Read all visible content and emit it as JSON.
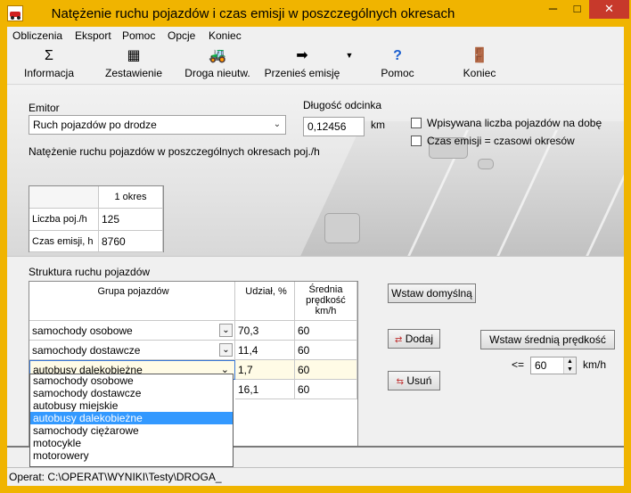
{
  "window": {
    "title": "Natężenie ruchu pojazdów i czas emisji w poszczególnych okresach",
    "min_glyph": "─",
    "max_glyph": "□",
    "close_glyph": "✕"
  },
  "menu": [
    "Obliczenia",
    "Eksport",
    "Pomoc",
    "Opcje",
    "Koniec"
  ],
  "toolbar": {
    "items": [
      {
        "label": "Informacja",
        "icon": "sigma-icon",
        "glyph": "Σ"
      },
      {
        "label": "Zestawienie",
        "icon": "table-icon",
        "glyph": "▦"
      },
      {
        "label": "Droga nieutw.",
        "icon": "road-vehicle-icon",
        "glyph": "🚜"
      },
      {
        "label": "Przenieś emisję",
        "icon": "transfer-icon",
        "glyph": "➡"
      },
      {
        "label": "Pomoc",
        "icon": "question-icon",
        "glyph": "?"
      },
      {
        "label": "Koniec",
        "icon": "exit-door-icon",
        "glyph": "🚪"
      }
    ],
    "dropdown_glyph": "▼"
  },
  "emitor": {
    "label": "Emitor",
    "value": "Ruch pojazdów po drodze",
    "arrow": "⌄"
  },
  "length": {
    "label": "Długość odcinka",
    "value": "0,12456",
    "unit": "km"
  },
  "checkboxes": [
    {
      "label": "Wpisywana liczba pojazdów na dobę",
      "checked": false
    },
    {
      "label": "Czas emisji = czasowi okresów",
      "checked": false
    }
  ],
  "intensity": {
    "heading": "Natężenie ruchu pojazdów w poszczególnych okresach poj./h",
    "column": "1 okres",
    "rows": [
      {
        "label": "Liczba poj./h",
        "value": "125"
      },
      {
        "label": "Czas emisji, h",
        "value": "8760"
      }
    ]
  },
  "structure": {
    "heading": "Struktura ruchu pojazdów",
    "headers": [
      "Grupa pojazdów",
      "Udział, %",
      "Średnia prędkość km/h"
    ],
    "rows": [
      {
        "group": "samochody osobowe",
        "share": "70,3",
        "speed": "60"
      },
      {
        "group": "samochody dostawcze",
        "share": "11,4",
        "speed": "60"
      },
      {
        "group": "autobusy dalekobieżne",
        "share": "1,7",
        "speed": "60"
      },
      {
        "group": "",
        "share": "16,1",
        "speed": "60"
      }
    ],
    "dropdown": [
      "samochody osobowe",
      "samochody dostawcze",
      "autobusy miejskie",
      "autobusy dalekobieżne",
      "samochody ciężarowe",
      "motocykle",
      "motorowery"
    ],
    "selected": "autobusy dalekobieżne"
  },
  "buttons": {
    "defaults": "Wstaw domyślną",
    "add": "Dodaj",
    "remove": "Usuń",
    "avg_speed": "Wstaw średnią prędkość"
  },
  "speed_limit": {
    "prefix": "<=",
    "value": "60",
    "unit": "km/h"
  },
  "status": "Operat: C:\\OPERAT\\WYNIKI\\Testy\\DROGA_"
}
